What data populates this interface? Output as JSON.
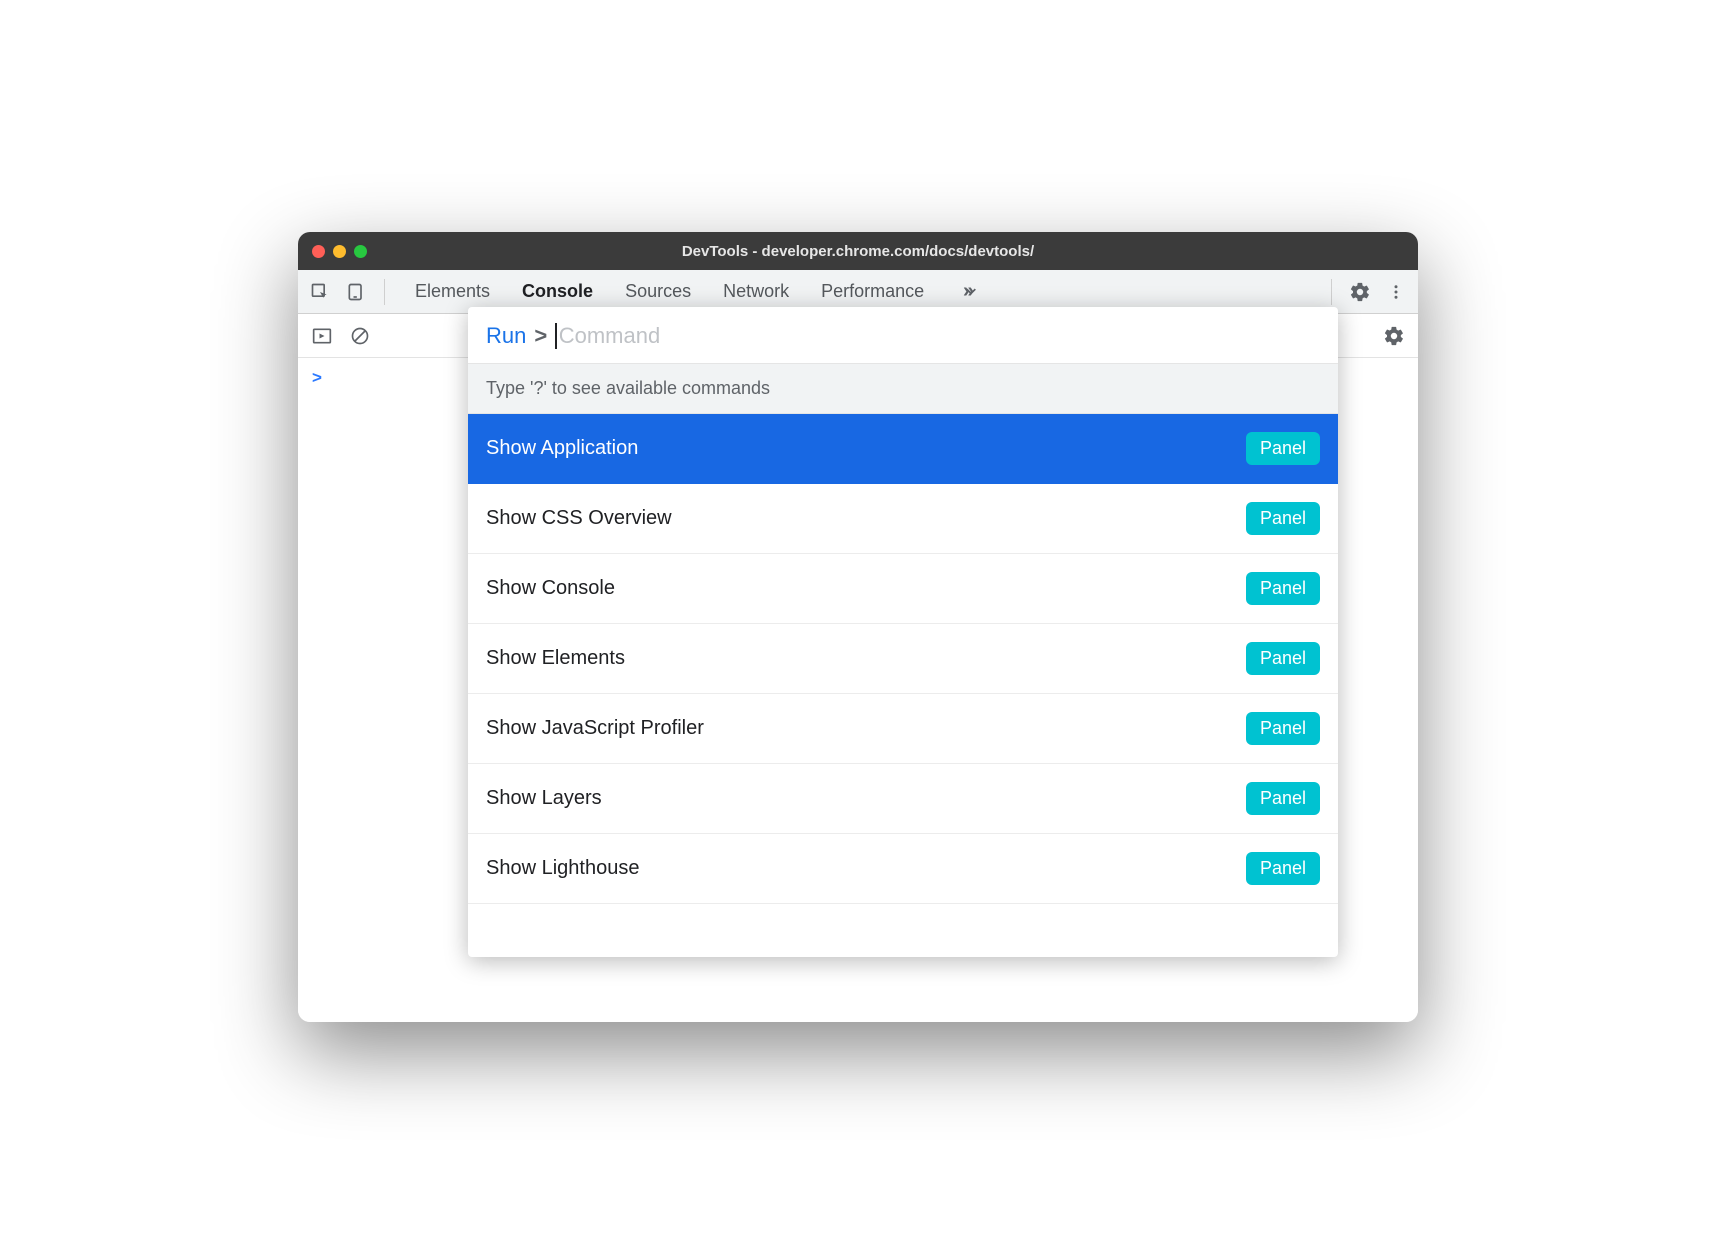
{
  "titlebar": {
    "title": "DevTools - developer.chrome.com/docs/devtools/"
  },
  "tabs": {
    "items": [
      "Elements",
      "Console",
      "Sources",
      "Network",
      "Performance"
    ],
    "active": "Console"
  },
  "console": {
    "prompt": ">"
  },
  "palette": {
    "run_label": "Run",
    "gt": ">",
    "placeholder": "Command",
    "hint": "Type '?' to see available commands",
    "badge_label": "Panel",
    "items": [
      {
        "label": "Show Application",
        "selected": true
      },
      {
        "label": "Show CSS Overview",
        "selected": false
      },
      {
        "label": "Show Console",
        "selected": false
      },
      {
        "label": "Show Elements",
        "selected": false
      },
      {
        "label": "Show JavaScript Profiler",
        "selected": false
      },
      {
        "label": "Show Layers",
        "selected": false
      },
      {
        "label": "Show Lighthouse",
        "selected": false
      }
    ]
  }
}
